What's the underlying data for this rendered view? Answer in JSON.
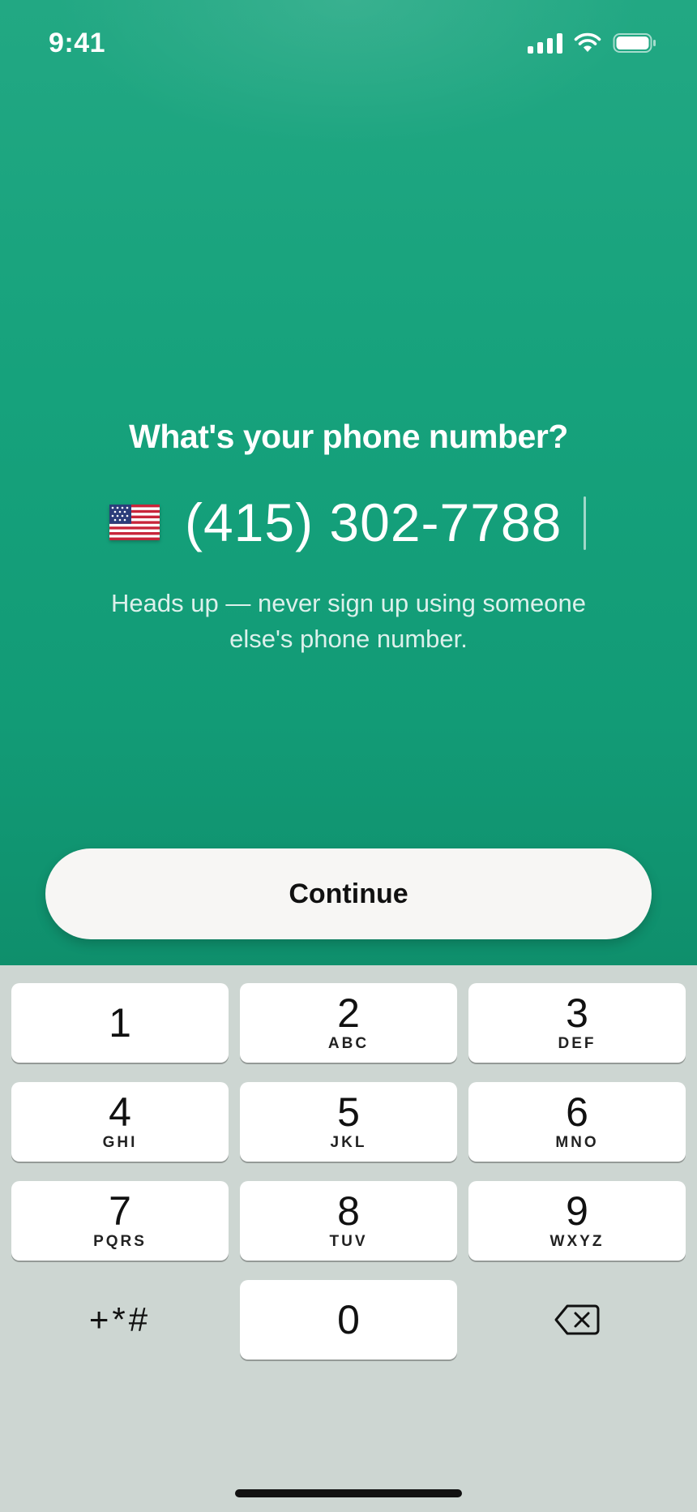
{
  "status_bar": {
    "time": "9:41"
  },
  "screen": {
    "title": "What's your phone number?",
    "phone_input": {
      "value": "(415) 302-7788",
      "country": "US"
    },
    "warning": "Heads up — never sign up using someone else's phone number.",
    "continue_label": "Continue",
    "accent_color": "#16a27c"
  },
  "keypad": {
    "keys": [
      {
        "digit": "1",
        "letters": ""
      },
      {
        "digit": "2",
        "letters": "ABC"
      },
      {
        "digit": "3",
        "letters": "DEF"
      },
      {
        "digit": "4",
        "letters": "GHI"
      },
      {
        "digit": "5",
        "letters": "JKL"
      },
      {
        "digit": "6",
        "letters": "MNO"
      },
      {
        "digit": "7",
        "letters": "PQRS"
      },
      {
        "digit": "8",
        "letters": "TUV"
      },
      {
        "digit": "9",
        "letters": "WXYZ"
      },
      {
        "digit": "0",
        "letters": ""
      }
    ],
    "symbols_label": "+*#",
    "delete_icon": "backspace-icon"
  }
}
